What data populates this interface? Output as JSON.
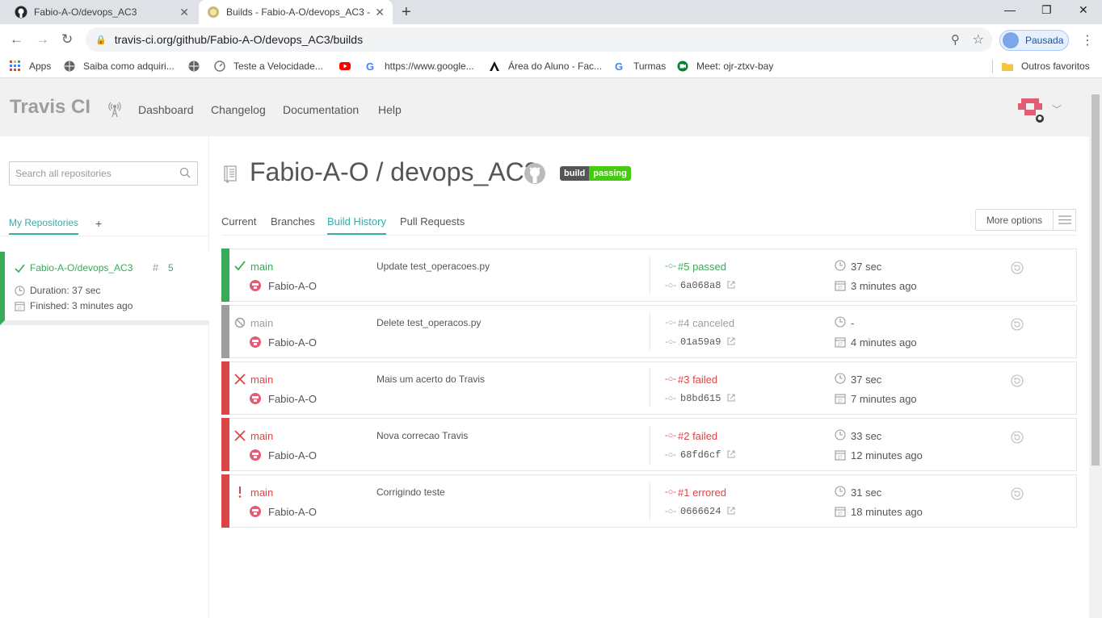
{
  "browser": {
    "tabs": [
      {
        "title": "Fabio-A-O/devops_AC3",
        "close": "✕"
      },
      {
        "title": "Builds - Fabio-A-O/devops_AC3 -",
        "close": "✕"
      }
    ],
    "new_tab": "+",
    "window_controls": {
      "minimize": "—",
      "restore": "❐",
      "close": "✕"
    },
    "url": "travis-ci.org/github/Fabio-A-O/devops_AC3/builds",
    "profile_label": "Pausada",
    "bookmarks": [
      {
        "label": "Apps",
        "icon": "apps-grid-icon"
      },
      {
        "label": "Saiba como adquiri...",
        "icon": "globe-icon"
      },
      {
        "label": "",
        "icon": "globe-icon"
      },
      {
        "label": "Teste a Velocidade...",
        "icon": "speedtest-icon"
      },
      {
        "label": "",
        "icon": "youtube-icon"
      },
      {
        "label": "https://www.google...",
        "icon": "google-icon"
      },
      {
        "label": "Área do Aluno - Fac...",
        "icon": "impacta-icon"
      },
      {
        "label": "Turmas",
        "icon": "google-icon"
      },
      {
        "label": "Meet: ojr-ztxv-bay",
        "icon": "meet-icon"
      },
      {
        "label": "Outros favoritos",
        "icon": "folder-icon"
      }
    ]
  },
  "travis": {
    "brand": "Travis CI",
    "nav": [
      "Dashboard",
      "Changelog",
      "Documentation",
      "Help"
    ],
    "sidebar": {
      "search_placeholder": "Search all repositories",
      "tab_active": "My Repositories",
      "tab_add": "+",
      "repo": {
        "name": "Fabio-A-O/devops_AC3",
        "hash": "#",
        "number": "5",
        "duration": "Duration: 37 sec",
        "finished": "Finished: 3 minutes ago"
      }
    },
    "repo_title": "Fabio-A-O / devops_AC3",
    "badge": {
      "left": "build",
      "right": "passing"
    },
    "tabs": [
      "Current",
      "Branches",
      "Build History",
      "Pull Requests"
    ],
    "more_options": "More options",
    "builds": [
      {
        "status": "passed",
        "branch": "main",
        "author": "Fabio-A-O",
        "message": "Update test_operacoes.py",
        "number": "#5 passed",
        "commit": "6a068a8",
        "duration": "37 sec",
        "ago": "3 minutes ago"
      },
      {
        "status": "canceled",
        "branch": "main",
        "author": "Fabio-A-O",
        "message": "Delete test_operacos.py",
        "number": "#4 canceled",
        "commit": "01a59a9",
        "duration": "-",
        "ago": "4 minutes ago"
      },
      {
        "status": "failed",
        "branch": "main",
        "author": "Fabio-A-O",
        "message": "Mais um acerto do Travis",
        "number": "#3 failed",
        "commit": "b8bd615",
        "duration": "37 sec",
        "ago": "7 minutes ago"
      },
      {
        "status": "failed",
        "branch": "main",
        "author": "Fabio-A-O",
        "message": "Nova correcao Travis",
        "number": "#2 failed",
        "commit": "68fd6cf",
        "duration": "33 sec",
        "ago": "12 minutes ago"
      },
      {
        "status": "errored",
        "branch": "main",
        "author": "Fabio-A-O",
        "message": "Corrigindo teste",
        "number": "#1 errored",
        "commit": "0666624",
        "duration": "31 sec",
        "ago": "18 minutes ago"
      }
    ]
  },
  "colors": {
    "passed": "#39aa56",
    "canceled": "#9d9d9d",
    "failed": "#db4545",
    "errored": "#db4545",
    "accent": "#39aaa8"
  }
}
